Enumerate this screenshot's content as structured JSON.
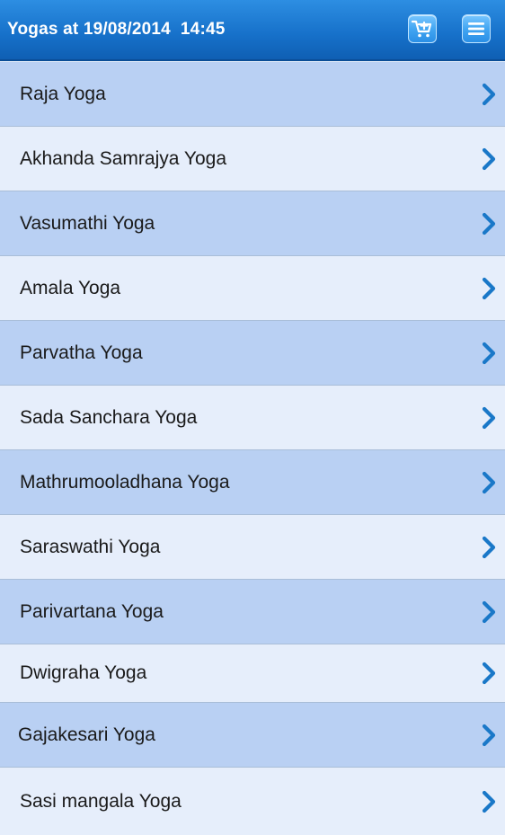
{
  "header": {
    "title": "Yogas at 19/08/2014  14:45",
    "actions": [
      {
        "name": "cart-add",
        "icon": "cart-add-icon"
      },
      {
        "name": "menu",
        "icon": "menu-icon"
      }
    ]
  },
  "list": {
    "items": [
      {
        "label": "Raja Yoga"
      },
      {
        "label": "Akhanda Samrajya Yoga"
      },
      {
        "label": "Vasumathi Yoga"
      },
      {
        "label": "Amala Yoga"
      },
      {
        "label": "Parvatha Yoga"
      },
      {
        "label": "Sada Sanchara Yoga"
      },
      {
        "label": "Mathrumooladhana Yoga"
      },
      {
        "label": "Saraswathi Yoga"
      },
      {
        "label": "Parivartana Yoga"
      },
      {
        "label": "Dwigraha Yoga"
      },
      {
        "label": "Gajakesari Yoga"
      },
      {
        "label": "Sasi mangala Yoga"
      }
    ],
    "chevron_icon": "chevron-right-icon"
  },
  "colors": {
    "header_blue": "#1670c9",
    "row_dark": "#b9d0f3",
    "row_light": "#e6eefb",
    "chevron": "#1a78c8"
  }
}
